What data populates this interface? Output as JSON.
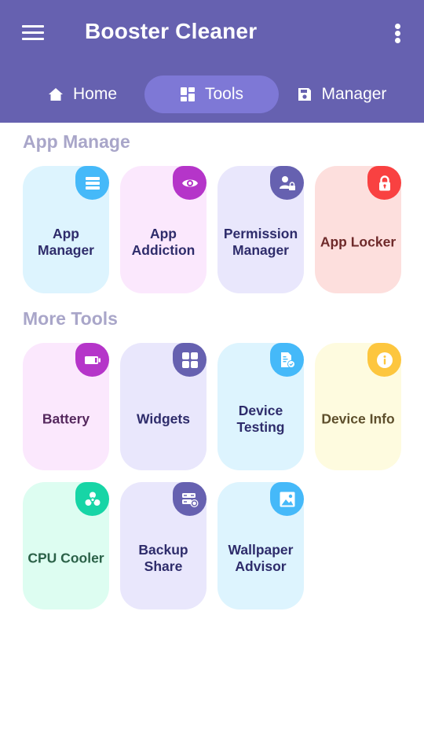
{
  "header": {
    "title": "Booster Cleaner",
    "menu_icon": "hamburger-menu-icon",
    "more_icon": "more-vertical-icon",
    "background": "#6661B0"
  },
  "tabs": [
    {
      "label": "Home",
      "icon": "home-icon",
      "active": false
    },
    {
      "label": "Tools",
      "icon": "dashboard-icon",
      "active": true
    },
    {
      "label": "Manager",
      "icon": "save-icon",
      "active": false
    }
  ],
  "sections": [
    {
      "title": "App Manage",
      "items": [
        {
          "label": "App Manager",
          "icon": "list-icon",
          "bg": "#DDF4FE",
          "badge": "#45B9F9",
          "text_color": "#2E2C6B"
        },
        {
          "label": "App Addiction",
          "icon": "eye-icon",
          "bg": "#FBE8FD",
          "badge": "#B535C9",
          "text_color": "#2E2C6B"
        },
        {
          "label": "Permission Manager",
          "icon": "user-lock-icon",
          "bg": "#E9E7FC",
          "badge": "#6661B0",
          "text_color": "#2E2C6B"
        },
        {
          "label": "App Locker",
          "icon": "lock-icon",
          "bg": "#FDDFDD",
          "badge": "#F94141",
          "text_color": "#6E2A2A"
        }
      ]
    },
    {
      "title": "More Tools",
      "items": [
        {
          "label": "Battery",
          "icon": "battery-icon",
          "bg": "#FBE8FD",
          "badge": "#B535C9",
          "text_color": "#55285E"
        },
        {
          "label": "Widgets",
          "icon": "widgets-icon",
          "bg": "#E9E7FC",
          "badge": "#6661B0",
          "text_color": "#2E2C6B"
        },
        {
          "label": "Device Testing",
          "icon": "document-check-icon",
          "bg": "#DDF4FE",
          "badge": "#45B9F9",
          "text_color": "#2E2C6B"
        },
        {
          "label": "Device Info",
          "icon": "info-icon",
          "bg": "#FEFBDF",
          "badge": "#FDC63E",
          "text_color": "#5E4F2C"
        },
        {
          "label": "CPU Cooler",
          "icon": "fan-icon",
          "bg": "#DDFDF1",
          "badge": "#17D5A6",
          "text_color": "#2B6148"
        },
        {
          "label": "Backup Share",
          "icon": "server-sync-icon",
          "bg": "#E9E7FC",
          "badge": "#6661B0",
          "text_color": "#2E2C6B"
        },
        {
          "label": "Wallpaper Advisor",
          "icon": "image-icon",
          "bg": "#DDF4FE",
          "badge": "#45B9F9",
          "text_color": "#2E2C6B"
        }
      ]
    }
  ]
}
